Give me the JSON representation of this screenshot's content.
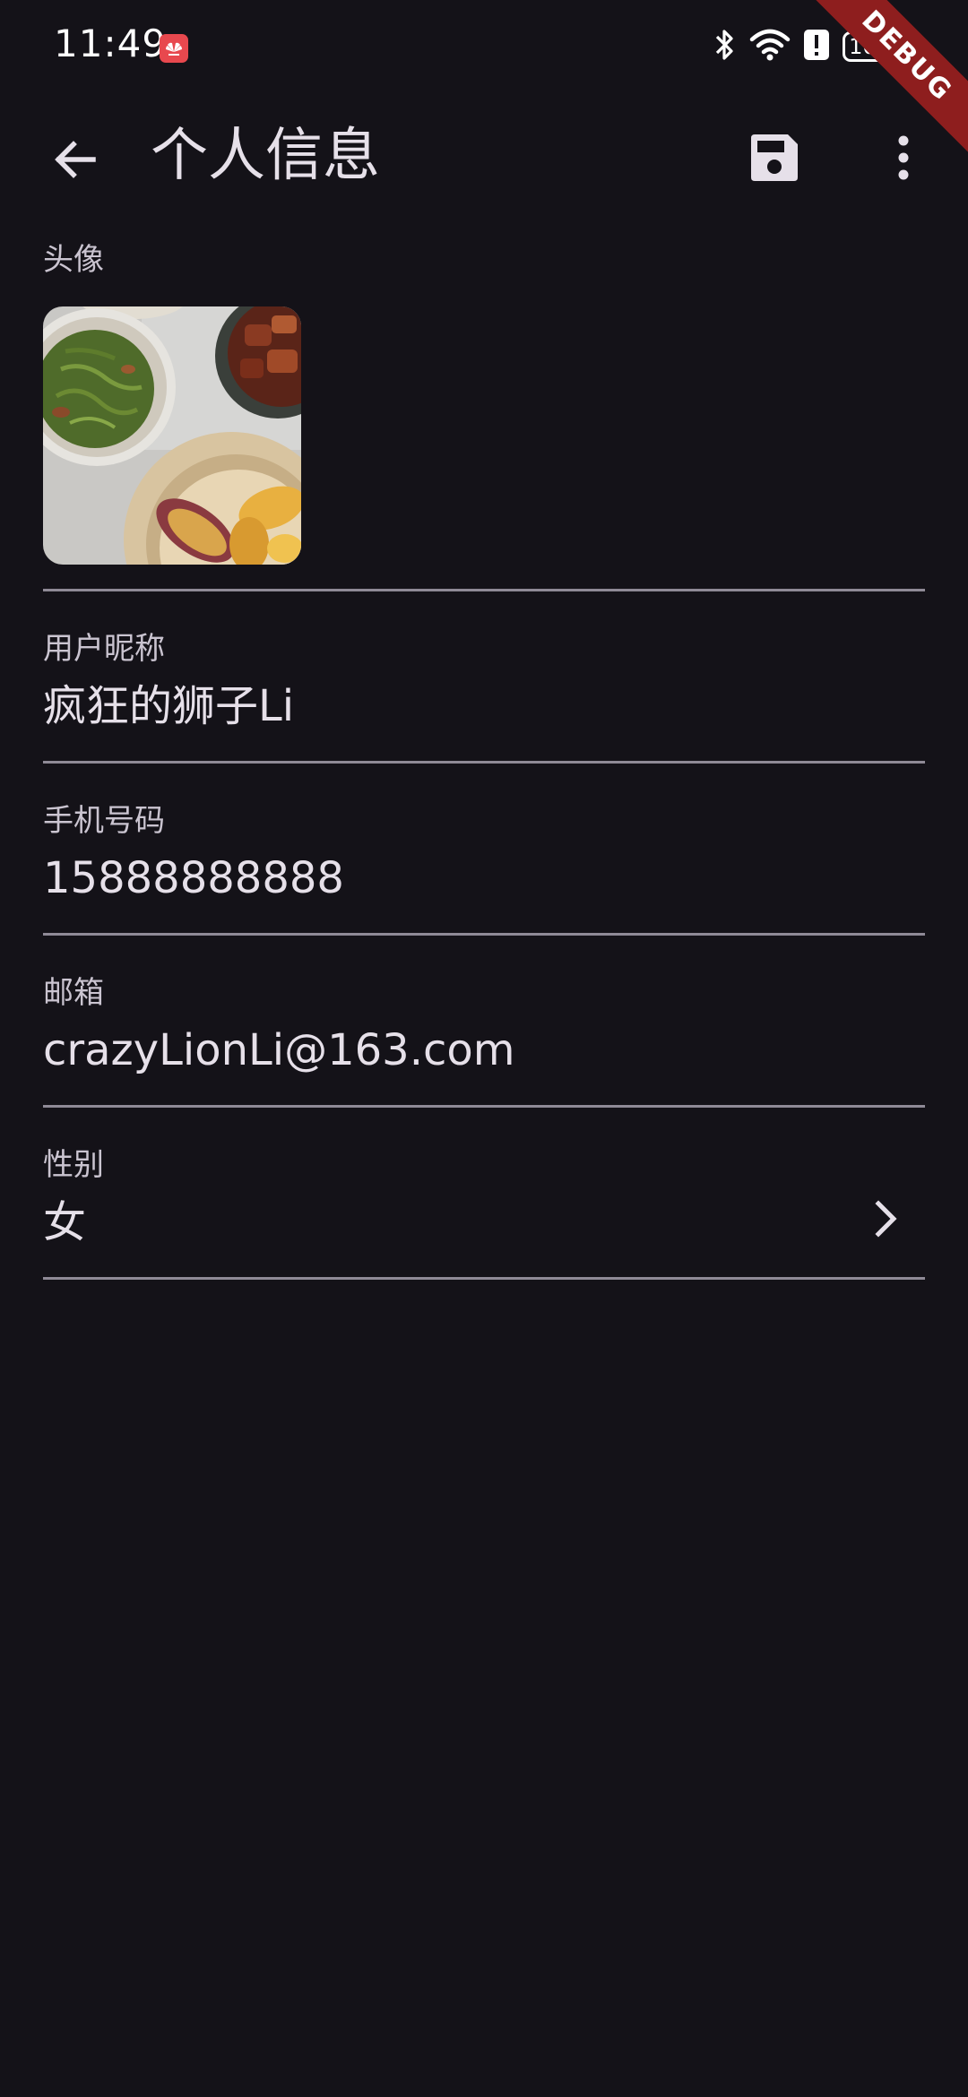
{
  "status_bar": {
    "time": "11:49",
    "battery": "100"
  },
  "debug_banner": "DEBUG",
  "app_bar": {
    "title": "个人信息",
    "icons": [
      "back-arrow-icon",
      "save-icon",
      "more-vert-icon"
    ]
  },
  "profile": {
    "avatar_label": "头像",
    "nickname_label": "用户昵称",
    "nickname": "疯狂的狮子Li",
    "phone_label": "手机号码",
    "phone": "15888888888",
    "email_label": "邮箱",
    "email": "crazyLionLi@163.com",
    "gender_label": "性别",
    "gender": "女"
  },
  "colors": {
    "background": "#141218",
    "text": "#e6e0e9",
    "label": "#cac4d0",
    "divider": "#8f8a96",
    "debug_ribbon": "#8e1e1e"
  }
}
